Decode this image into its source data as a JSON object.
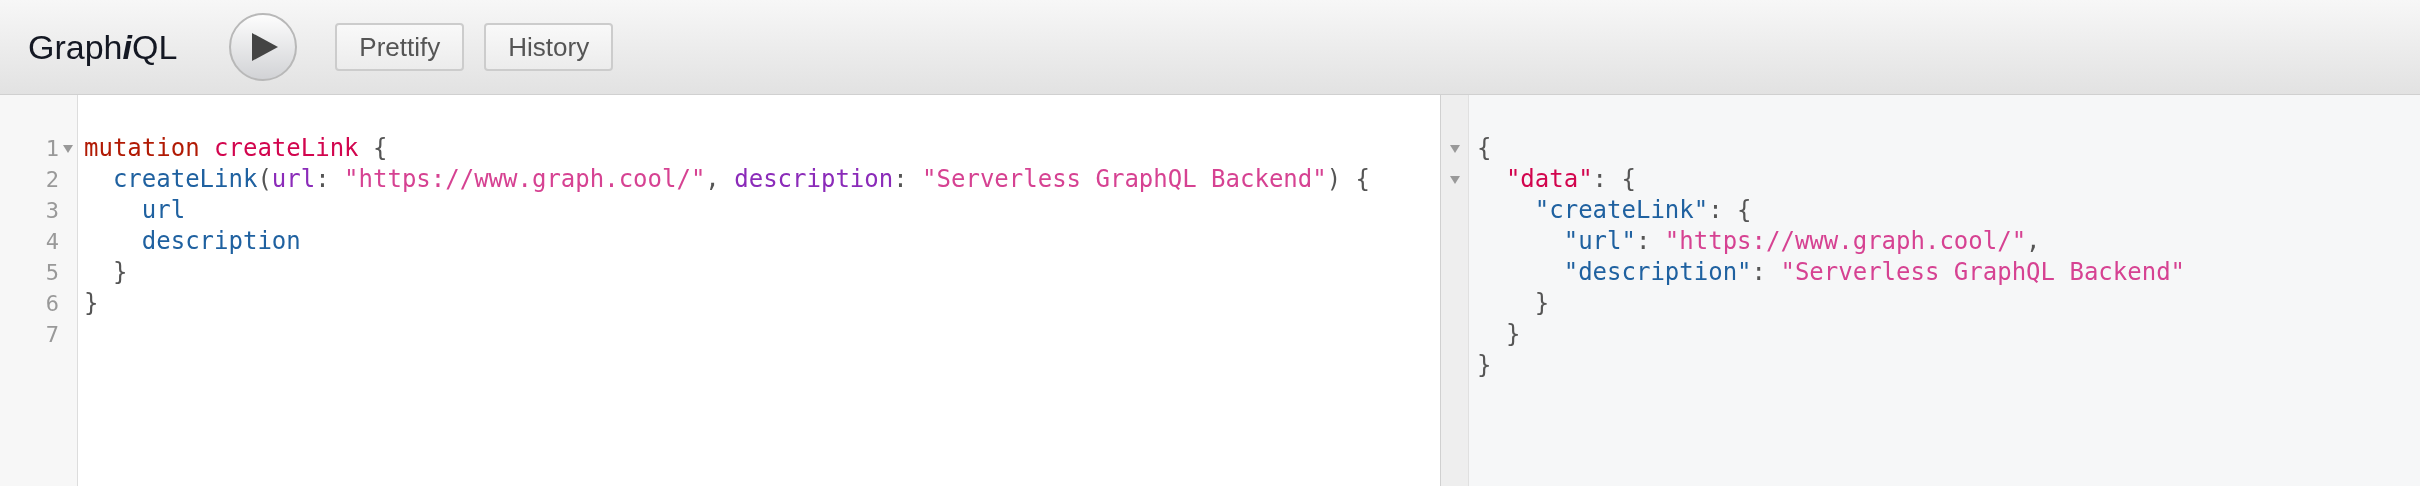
{
  "toolbar": {
    "title": [
      {
        "text": "Graph",
        "italic": false
      },
      {
        "text": "i",
        "italic": true
      },
      {
        "text": "QL",
        "italic": false
      }
    ],
    "buttons": [
      {
        "label": "Prettify"
      },
      {
        "label": "History"
      }
    ]
  },
  "editor": {
    "lines": [
      {
        "number": "1",
        "foldable": true,
        "tokens": [
          {
            "kind": "keyword",
            "text": "mutation"
          },
          {
            "kind": "def",
            "text": " createLink"
          },
          {
            "kind": "punct",
            "text": " {"
          }
        ]
      },
      {
        "number": "2",
        "foldable": false,
        "tokens": [
          {
            "kind": "field",
            "text": "  createLink"
          },
          {
            "kind": "punct",
            "text": "("
          },
          {
            "kind": "attr",
            "text": "url"
          },
          {
            "kind": "punct",
            "text": ": "
          },
          {
            "kind": "string",
            "text": "\"https://www.graph.cool/\""
          },
          {
            "kind": "punct",
            "text": ", "
          },
          {
            "kind": "attr",
            "text": "description"
          },
          {
            "kind": "punct",
            "text": ": "
          },
          {
            "kind": "string",
            "text": "\"Serverless GraphQL Backend\""
          },
          {
            "kind": "punct",
            "text": ") {"
          }
        ]
      },
      {
        "number": "3",
        "foldable": false,
        "tokens": [
          {
            "kind": "field",
            "text": "    url"
          }
        ]
      },
      {
        "number": "4",
        "foldable": false,
        "tokens": [
          {
            "kind": "field",
            "text": "    description"
          }
        ]
      },
      {
        "number": "5",
        "foldable": false,
        "tokens": [
          {
            "kind": "punct",
            "text": "  }"
          }
        ]
      },
      {
        "number": "6",
        "foldable": false,
        "tokens": [
          {
            "kind": "punct",
            "text": "}"
          }
        ]
      },
      {
        "number": "7",
        "foldable": false
      }
    ]
  },
  "result": {
    "lines": [
      {
        "foldable": true,
        "tokens": [
          {
            "kind": "punct",
            "text": "{"
          }
        ]
      },
      {
        "foldable": true,
        "tokens": [
          {
            "kind": "def",
            "text": "  \"data\""
          },
          {
            "kind": "punct",
            "text": ": {"
          }
        ]
      },
      {
        "foldable": false,
        "tokens": [
          {
            "kind": "field",
            "text": "    \"createLink\""
          },
          {
            "kind": "punct",
            "text": ": {"
          }
        ]
      },
      {
        "foldable": false,
        "tokens": [
          {
            "kind": "field",
            "text": "      \"url\""
          },
          {
            "kind": "punct",
            "text": ": "
          },
          {
            "kind": "string",
            "text": "\"https://www.graph.cool/\""
          },
          {
            "kind": "punct",
            "text": ","
          }
        ]
      },
      {
        "foldable": false,
        "tokens": [
          {
            "kind": "field",
            "text": "      \"description\""
          },
          {
            "kind": "punct",
            "text": ": "
          },
          {
            "kind": "string",
            "text": "\"Serverless GraphQL Backend\""
          }
        ]
      },
      {
        "foldable": false,
        "tokens": [
          {
            "kind": "punct",
            "text": "    }"
          }
        ]
      },
      {
        "foldable": false,
        "tokens": [
          {
            "kind": "punct",
            "text": "  }"
          }
        ]
      },
      {
        "foldable": false,
        "tokens": [
          {
            "kind": "punct",
            "text": "}"
          }
        ]
      }
    ]
  }
}
